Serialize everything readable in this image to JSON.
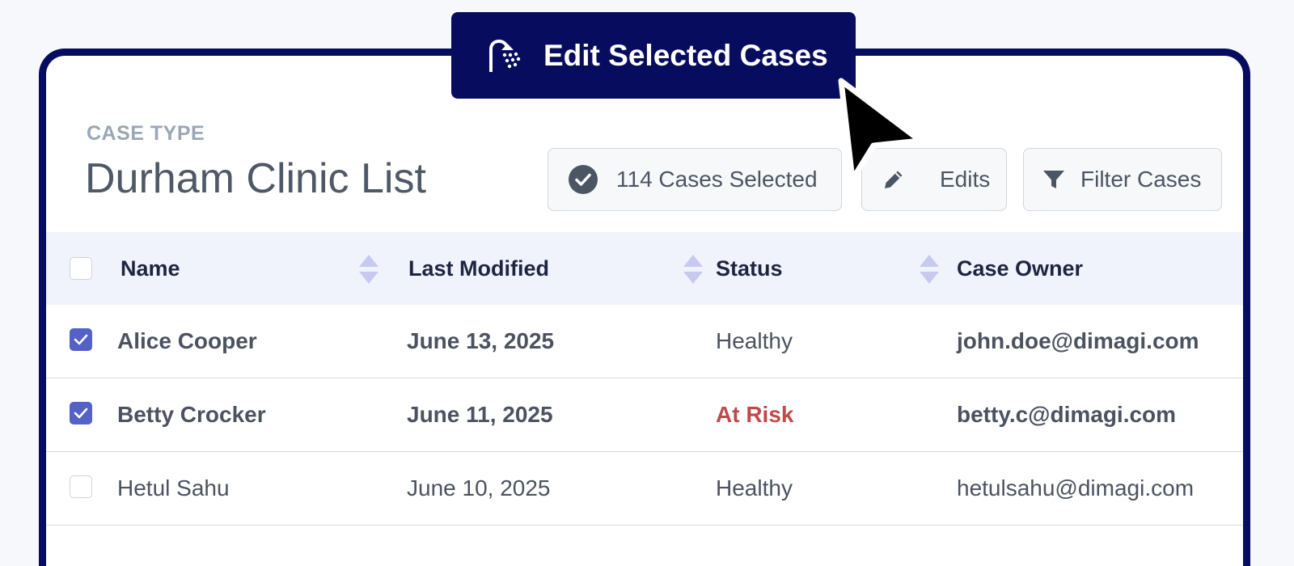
{
  "header": {
    "eyebrow": "CASE TYPE",
    "title": "Durham Clinic List"
  },
  "toolbar": {
    "selected_label": "114 Cases Selected",
    "edits_label": "Edits",
    "filter_label": "Filter Cases"
  },
  "bulk_action": {
    "label": "Edit Selected Cases"
  },
  "table": {
    "columns": [
      "Name",
      "Last Modified",
      "Status",
      "Case Owner"
    ],
    "rows": [
      {
        "selected": true,
        "name": "Alice Cooper",
        "modified": "June 13, 2025",
        "status": "Healthy",
        "owner": "john.doe@dimagi.com"
      },
      {
        "selected": true,
        "name": "Betty Crocker",
        "modified": "June 11, 2025",
        "status": "At Risk",
        "owner": "betty.c@dimagi.com"
      },
      {
        "selected": false,
        "name": "Hetul Sahu",
        "modified": "June 10, 2025",
        "status": "Healthy",
        "owner": "hetulsahu@dimagi.com"
      }
    ]
  },
  "colors": {
    "brand": "#080c5e",
    "checkbox": "#5461c7",
    "at_risk": "#c04a4a",
    "header_bg": "#f1f3fc"
  },
  "icons": [
    "shower-icon",
    "check-circle-icon",
    "pencil-icon",
    "filter-icon",
    "sort-icon",
    "cursor-icon"
  ]
}
